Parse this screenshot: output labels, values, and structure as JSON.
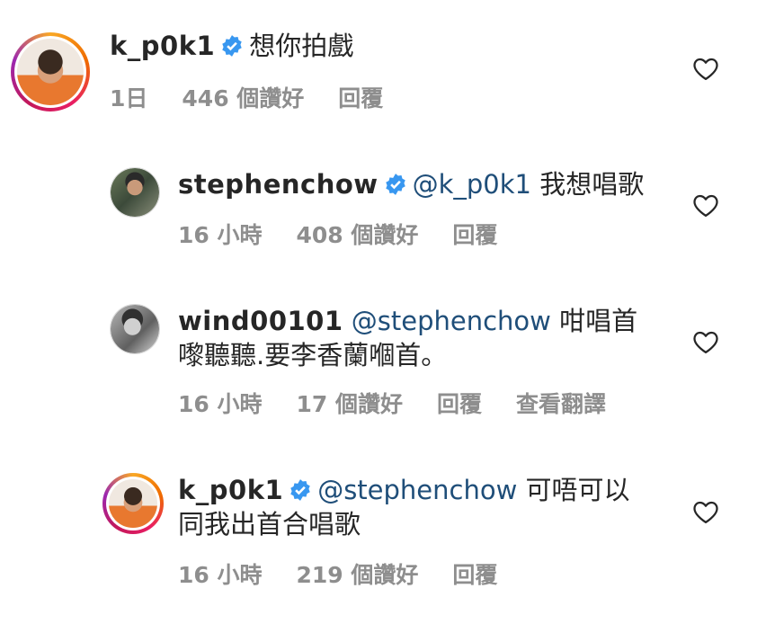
{
  "comments": [
    {
      "username": "k_p0k1",
      "verified": true,
      "mention": "",
      "text": "想你拍戲",
      "time": "1日",
      "likes": "446 個讚好",
      "reply": "回覆",
      "translate": ""
    },
    {
      "username": "stephenchow",
      "verified": true,
      "mention": "@k_p0k1",
      "text": "我想唱歌",
      "time": "16 小時",
      "likes": "408 個讚好",
      "reply": "回覆",
      "translate": ""
    },
    {
      "username": "wind00101",
      "verified": false,
      "mention": "@stephenchow",
      "text_line1": "咁唱首",
      "text_line2": "嚟聽聽.要李香蘭嗰首。",
      "time": "16 小時",
      "likes": "17 個讚好",
      "reply": "回覆",
      "translate": "查看翻譯"
    },
    {
      "username": "k_p0k1",
      "verified": true,
      "mention": "@stephenchow",
      "text_line1": "可唔可以",
      "text_line2": "同我出首合唱歌",
      "time": "16 小時",
      "likes": "219 個讚好",
      "reply": "回覆",
      "translate": ""
    }
  ],
  "icons": {
    "verified": "verified-badge-icon",
    "like": "heart-outline-icon"
  },
  "colors": {
    "verified_blue": "#3897f0",
    "meta_gray": "#8e8e8e",
    "text": "#262626",
    "mention": "#1f4e79"
  }
}
